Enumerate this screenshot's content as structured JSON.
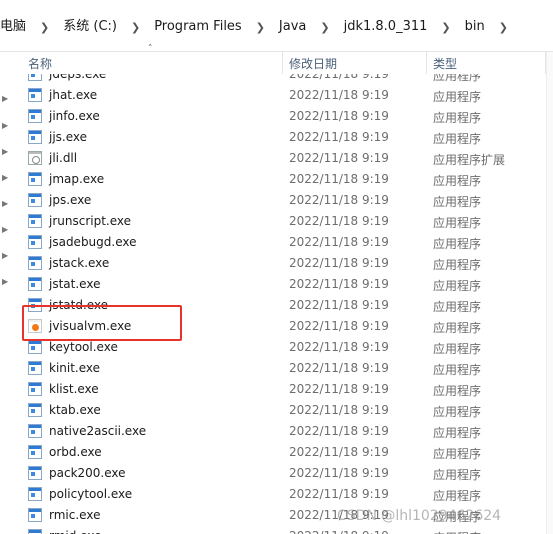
{
  "breadcrumbs": [
    "电脑",
    "系统 (C:)",
    "Program Files",
    "Java",
    "jdk1.8.0_311",
    "bin"
  ],
  "columns": {
    "name": "名称",
    "date": "修改日期",
    "type": "类型"
  },
  "files": [
    {
      "name": "jdeps.exe",
      "date": "2022/11/18 9:19",
      "type": "应用程序",
      "icon": "exe-icon"
    },
    {
      "name": "jhat.exe",
      "date": "2022/11/18 9:19",
      "type": "应用程序",
      "icon": "exe-icon"
    },
    {
      "name": "jinfo.exe",
      "date": "2022/11/18 9:19",
      "type": "应用程序",
      "icon": "exe-icon"
    },
    {
      "name": "jjs.exe",
      "date": "2022/11/18 9:19",
      "type": "应用程序",
      "icon": "exe-icon"
    },
    {
      "name": "jli.dll",
      "date": "2022/11/18 9:19",
      "type": "应用程序扩展",
      "icon": "dll-icon"
    },
    {
      "name": "jmap.exe",
      "date": "2022/11/18 9:19",
      "type": "应用程序",
      "icon": "exe-icon"
    },
    {
      "name": "jps.exe",
      "date": "2022/11/18 9:19",
      "type": "应用程序",
      "icon": "exe-icon"
    },
    {
      "name": "jrunscript.exe",
      "date": "2022/11/18 9:19",
      "type": "应用程序",
      "icon": "exe-icon"
    },
    {
      "name": "jsadebugd.exe",
      "date": "2022/11/18 9:19",
      "type": "应用程序",
      "icon": "exe-icon"
    },
    {
      "name": "jstack.exe",
      "date": "2022/11/18 9:19",
      "type": "应用程序",
      "icon": "exe-icon"
    },
    {
      "name": "jstat.exe",
      "date": "2022/11/18 9:19",
      "type": "应用程序",
      "icon": "exe-icon"
    },
    {
      "name": "jstatd.exe",
      "date": "2022/11/18 9:19",
      "type": "应用程序",
      "icon": "exe-icon"
    },
    {
      "name": "jvisualvm.exe",
      "date": "2022/11/18 9:19",
      "type": "应用程序",
      "icon": "visualvm-icon"
    },
    {
      "name": "keytool.exe",
      "date": "2022/11/18 9:19",
      "type": "应用程序",
      "icon": "exe-icon"
    },
    {
      "name": "kinit.exe",
      "date": "2022/11/18 9:19",
      "type": "应用程序",
      "icon": "exe-icon"
    },
    {
      "name": "klist.exe",
      "date": "2022/11/18 9:19",
      "type": "应用程序",
      "icon": "exe-icon"
    },
    {
      "name": "ktab.exe",
      "date": "2022/11/18 9:19",
      "type": "应用程序",
      "icon": "exe-icon"
    },
    {
      "name": "native2ascii.exe",
      "date": "2022/11/18 9:19",
      "type": "应用程序",
      "icon": "exe-icon"
    },
    {
      "name": "orbd.exe",
      "date": "2022/11/18 9:19",
      "type": "应用程序",
      "icon": "exe-icon"
    },
    {
      "name": "pack200.exe",
      "date": "2022/11/18 9:19",
      "type": "应用程序",
      "icon": "exe-icon"
    },
    {
      "name": "policytool.exe",
      "date": "2022/11/18 9:19",
      "type": "应用程序",
      "icon": "exe-icon"
    },
    {
      "name": "rmic.exe",
      "date": "2022/11/18 9:19",
      "type": "应用程序",
      "icon": "exe-icon"
    },
    {
      "name": "rmid.exe",
      "date": "2022/11/18 9:19",
      "type": "应用程序",
      "icon": "exe-icon"
    }
  ],
  "highlighted_file": "jvisualvm.exe",
  "watermark": "CSDN @lhl1029462624",
  "colors": {
    "highlight_border": "#e8322c",
    "selected_row": "#ddeaf6",
    "header_text": "#4c607a"
  }
}
